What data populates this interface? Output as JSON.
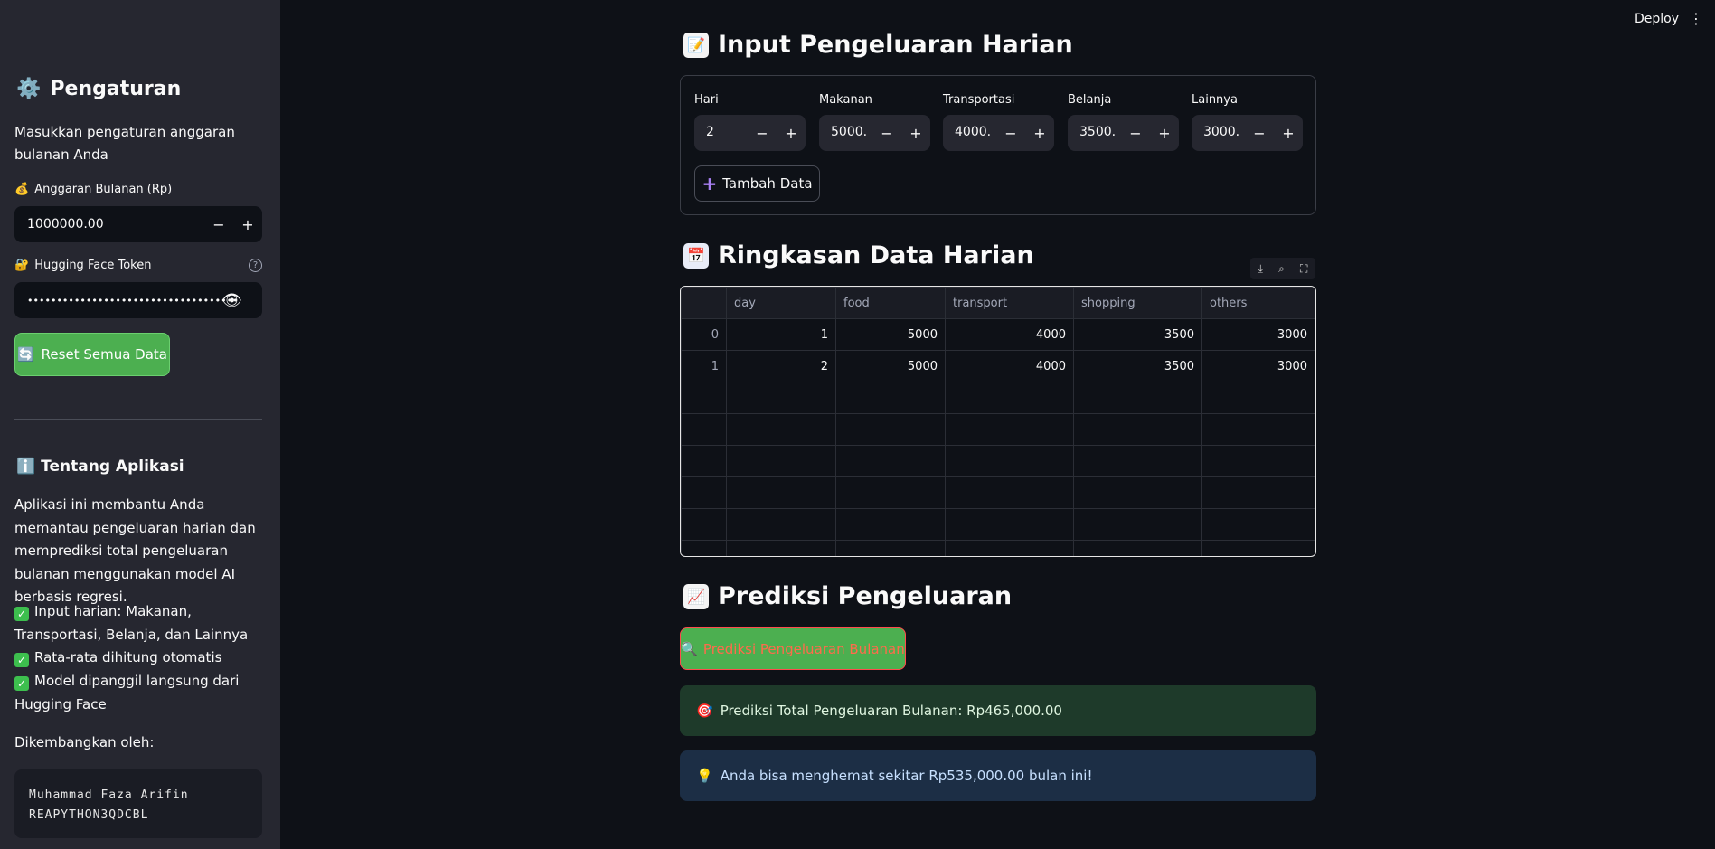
{
  "header": {
    "deploy_label": "Deploy",
    "more_icon": "⋮"
  },
  "sidebar": {
    "title": "Pengaturan",
    "subtitle": "Masukkan pengaturan anggaran bulanan Anda",
    "budget_label": "Anggaran Bulanan (Rp)",
    "budget_value": "1000000.00",
    "token_label": "Hugging Face Token",
    "token_value": "••••••••••••••••••••••••••••••••••••",
    "reset_label": "Reset Semua Data",
    "about_title": "Tentang Aplikasi",
    "about_text": "Aplikasi ini membantu Anda memantau pengeluaran harian dan memprediksi total pengeluaran bulanan menggunakan model AI berbasis regresi.",
    "features": [
      "Input harian: Makanan, Transportasi, Belanja, dan Lainnya",
      "Rata-rata dihitung otomatis",
      "Model dipanggil langsung dari Hugging Face"
    ],
    "dev_label": "Dikembangkan oleh:",
    "dev_name": "Muhammad Faza Arifin",
    "dev_id": "REAPYTHON3QDCBL"
  },
  "input_section": {
    "title": "Input Pengeluaran Harian",
    "fields": [
      {
        "label": "Hari",
        "value": "2"
      },
      {
        "label": "Makanan",
        "value": "5000."
      },
      {
        "label": "Transportasi",
        "value": "4000."
      },
      {
        "label": "Belanja",
        "value": "3500."
      },
      {
        "label": "Lainnya",
        "value": "3000."
      }
    ],
    "add_label": "Tambah Data"
  },
  "summary": {
    "title": "Ringkasan Data Harian",
    "columns": [
      "",
      "day",
      "food",
      "transport",
      "shopping",
      "others"
    ],
    "rows": [
      [
        "0",
        "1",
        "5000",
        "4000",
        "3500",
        "3000"
      ],
      [
        "1",
        "2",
        "5000",
        "4000",
        "3500",
        "3000"
      ]
    ]
  },
  "prediction": {
    "title": "Prediksi Pengeluaran",
    "button_label": "Prediksi Pengeluaran Bulanan",
    "result": "Prediksi Total Pengeluaran Bulanan: Rp465,000.00",
    "saving": "Anda bisa menghemat sekitar Rp535,000.00 bulan ini!"
  },
  "colors": {
    "accent_green": "#4caf50",
    "primary_red": "#ff4b4b",
    "bg": "#0e1117",
    "sidebar_bg": "#262730"
  }
}
